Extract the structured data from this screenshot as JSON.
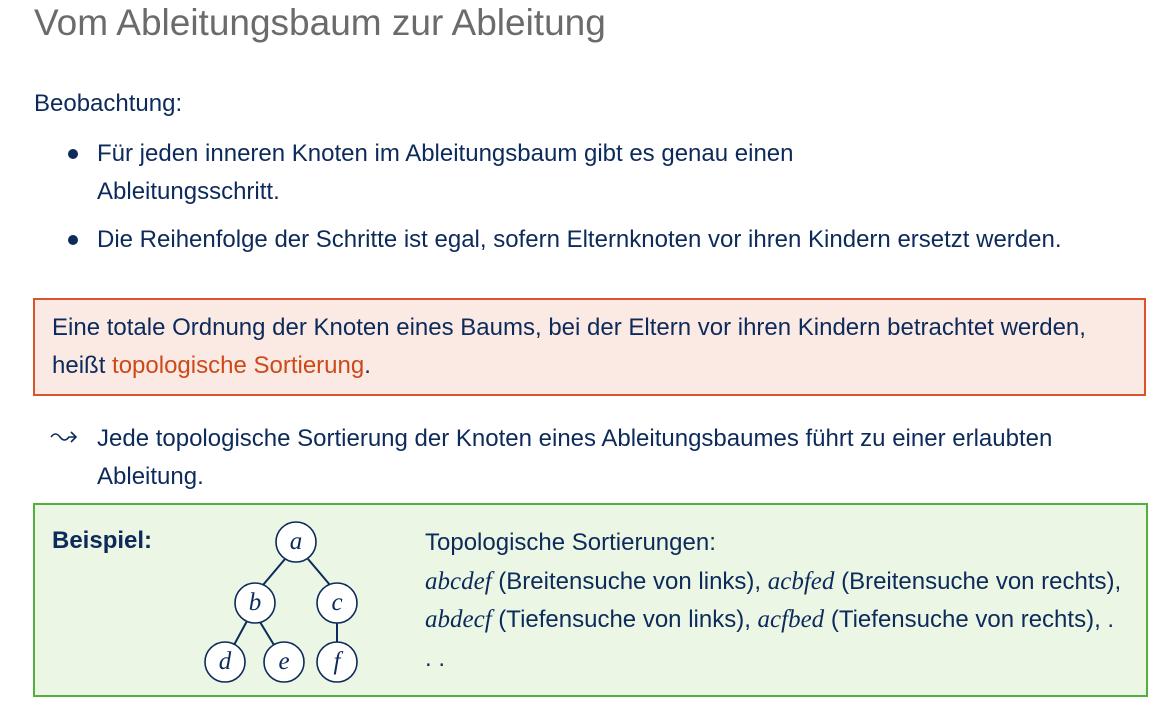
{
  "title": "Vom Ableitungsbaum zur Ableitung",
  "observation": {
    "label": "Beobachtung:",
    "bullets": [
      "Für jeden inneren Knoten im Ableitungsbaum gibt es genau einen Ableitungsschritt.",
      "Die Reihenfolge der Schritte ist egal, sofern Elternknoten vor ihren Kindern ersetzt werden."
    ]
  },
  "definition": {
    "text_before": "Eine totale Ordnung der Knoten eines Baums, bei der Eltern vor ihren Kindern be­trachtet werden, heißt ",
    "highlight": "topologische Sortierung",
    "text_after": ".",
    "highlight_color": "#cc4a18"
  },
  "conclusion": {
    "icon": "leadsto-arrow-icon",
    "text": "Jede topologische Sortierung der Knoten eines Ableitungsbaumes führt zu einer erlaubten Ableitung."
  },
  "example": {
    "label": "Beispiel:",
    "tree": {
      "nodes": [
        "a",
        "b",
        "c",
        "d",
        "e",
        "f"
      ]
    },
    "heading": "Topologische Sortierungen:",
    "orders": [
      {
        "seq": "abcdef",
        "desc": " (Breitensuche von links), "
      },
      {
        "seq": "acbfed",
        "desc": " (Breitensuche von rechts), "
      },
      {
        "seq": "abdecf",
        "desc": " (Tiefensuche von links), "
      },
      {
        "seq": "acfbed",
        "desc": " (Tie­fensuche von rechts), . . ."
      }
    ]
  },
  "colors": {
    "text": "#0c2a5a",
    "title": "#6b6b6b",
    "def_border": "#d9542a",
    "def_bg": "#fbe9e4",
    "example_border": "#54b03c",
    "example_bg": "#ebf7e4"
  }
}
